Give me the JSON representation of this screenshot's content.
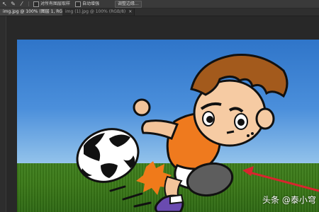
{
  "options_bar": {
    "tools": [
      "move-arrow",
      "brush",
      "eyedropper"
    ],
    "checkbox_label": "对所有图层取样",
    "auto_enhance_label": "自动增强",
    "refine_edge_button": "调整边缘..."
  },
  "tabs": [
    {
      "label": "img.jpg @ 100% (图层 1, RGB/8)",
      "active": true
    },
    {
      "label": "img (1).jpg @ 100% (RGB/8)",
      "active": false
    }
  ],
  "watermark": "头条 @泰小穹",
  "colors": {
    "sky_top": "#2f75c9",
    "grass": "#3b7a18",
    "shirt": "#ef7a1e",
    "hair": "#a35a1c",
    "arrow": "#d8252e"
  },
  "icons": [
    "move-icon",
    "brush-icon",
    "eyedropper-icon",
    "close-icon"
  ]
}
